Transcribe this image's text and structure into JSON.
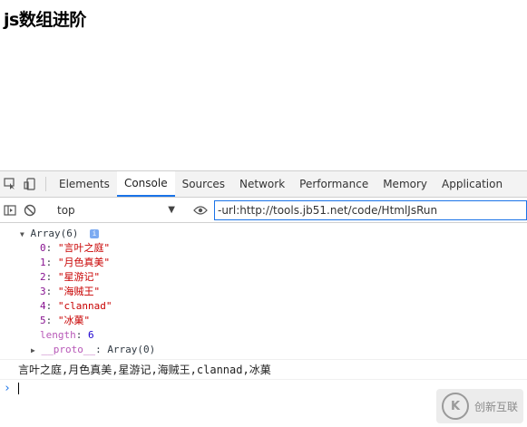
{
  "page": {
    "title": "js数组进阶"
  },
  "devtools": {
    "tabs": [
      "Elements",
      "Console",
      "Sources",
      "Network",
      "Performance",
      "Memory",
      "Application"
    ],
    "active_tab": "Console",
    "context": "top",
    "filter_value": "-url:http://tools.jb51.net/code/HtmlJsRun"
  },
  "console": {
    "array_header": "Array(6)",
    "info_badge": "i",
    "items": [
      {
        "index": "0",
        "value": "\"言叶之庭\""
      },
      {
        "index": "1",
        "value": "\"月色真美\""
      },
      {
        "index": "2",
        "value": "\"星游记\""
      },
      {
        "index": "3",
        "value": "\"海贼王\""
      },
      {
        "index": "4",
        "value": "\"clannad\""
      },
      {
        "index": "5",
        "value": "\"冰菓\""
      }
    ],
    "length_key": "length",
    "length_value": "6",
    "proto_key": "__proto__",
    "proto_value": "Array(0)",
    "joined_output": "言叶之庭,月色真美,星游记,海贼王,clannad,冰菓"
  },
  "watermark": {
    "logo_text": "K",
    "text": "创新互联"
  }
}
